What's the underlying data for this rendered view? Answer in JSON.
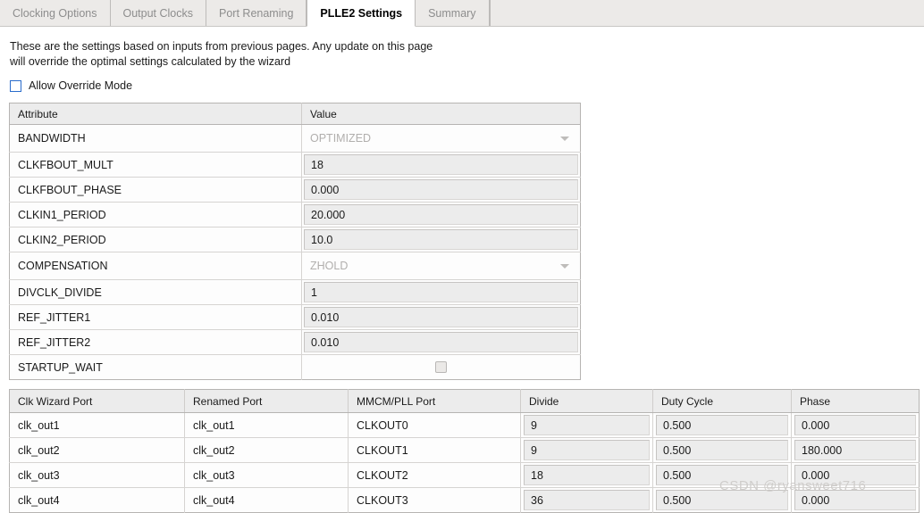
{
  "tabs": [
    {
      "label": "Clocking Options",
      "active": false
    },
    {
      "label": "Output Clocks",
      "active": false
    },
    {
      "label": "Port Renaming",
      "active": false
    },
    {
      "label": "PLLE2 Settings",
      "active": true
    },
    {
      "label": "Summary",
      "active": false
    }
  ],
  "description": {
    "line1": "These are the settings based on inputs from previous pages. Any update on this page",
    "line2": "will override the optimal settings calculated by the wizard"
  },
  "override": {
    "label": "Allow Override Mode",
    "checked": false
  },
  "attribute_table": {
    "headers": [
      "Attribute",
      "Value"
    ],
    "rows": [
      {
        "attribute": "BANDWIDTH",
        "value": "OPTIMIZED",
        "kind": "combo"
      },
      {
        "attribute": "CLKFBOUT_MULT",
        "value": "18",
        "kind": "text"
      },
      {
        "attribute": "CLKFBOUT_PHASE",
        "value": "0.000",
        "kind": "text"
      },
      {
        "attribute": "CLKIN1_PERIOD",
        "value": "20.000",
        "kind": "text"
      },
      {
        "attribute": "CLKIN2_PERIOD",
        "value": "10.0",
        "kind": "text"
      },
      {
        "attribute": "COMPENSATION",
        "value": "ZHOLD",
        "kind": "combo"
      },
      {
        "attribute": "DIVCLK_DIVIDE",
        "value": "1",
        "kind": "text"
      },
      {
        "attribute": "REF_JITTER1",
        "value": "0.010",
        "kind": "text"
      },
      {
        "attribute": "REF_JITTER2",
        "value": "0.010",
        "kind": "text"
      },
      {
        "attribute": "STARTUP_WAIT",
        "value": "",
        "kind": "checkbox"
      }
    ]
  },
  "ports_table": {
    "headers": [
      "Clk Wizard Port",
      "Renamed Port",
      "MMCM/PLL Port",
      "Divide",
      "Duty Cycle",
      "Phase"
    ],
    "rows": [
      {
        "wizard_port": "clk_out1",
        "renamed_port": "clk_out1",
        "mmcm_port": "CLKOUT0",
        "divide": "9",
        "duty_cycle": "0.500",
        "phase": "0.000"
      },
      {
        "wizard_port": "clk_out2",
        "renamed_port": "clk_out2",
        "mmcm_port": "CLKOUT1",
        "divide": "9",
        "duty_cycle": "0.500",
        "phase": "180.000"
      },
      {
        "wizard_port": "clk_out3",
        "renamed_port": "clk_out3",
        "mmcm_port": "CLKOUT2",
        "divide": "18",
        "duty_cycle": "0.500",
        "phase": "0.000"
      },
      {
        "wizard_port": "clk_out4",
        "renamed_port": "clk_out4",
        "mmcm_port": "CLKOUT3",
        "divide": "36",
        "duty_cycle": "0.500",
        "phase": "0.000"
      }
    ]
  },
  "watermark": {
    "text": "CSDN @ryansweet716"
  },
  "colors": {
    "tabbar_background": "#eceae8",
    "active_tab_background": "#ffffff",
    "inactive_tab_text": "#8d8d8d",
    "table_header_background": "#ececec",
    "field_background": "#ececec",
    "checkbox_accent": "#2a6ccb",
    "disabled_text": "#b1afad"
  }
}
